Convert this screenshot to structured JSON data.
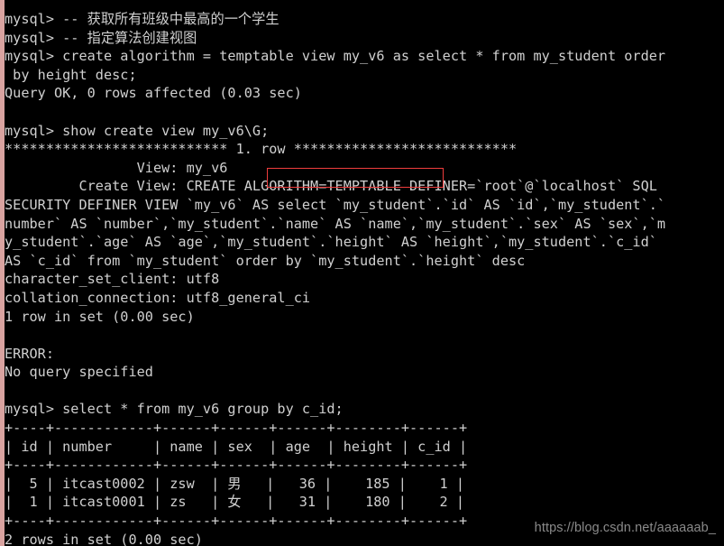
{
  "terminal": {
    "title": "MySQL Console",
    "background_color": "#000000",
    "foreground_color": "#d0d0d0",
    "left_edge_color": "#d9a3a0",
    "highlight_color": "#ef3d3d",
    "highlighted_text": "ALGORITHM=TEMPTABLE",
    "prompt": "mysql>",
    "lines": [
      "mysql> -- 获取所有班级中最高的一个学生",
      "mysql> -- 指定算法创建视图",
      "mysql> create algorithm = temptable view my_v6 as select * from my_student order",
      " by height desc;",
      "Query OK, 0 rows affected (0.03 sec)",
      "",
      "mysql> show create view my_v6\\G;",
      "*************************** 1. row ***************************",
      "                View: my_v6",
      "         Create View: CREATE ALGORITHM=TEMPTABLE DEFINER=`root`@`localhost` SQL",
      "SECURITY DEFINER VIEW `my_v6` AS select `my_student`.`id` AS `id`,`my_student`.`",
      "number` AS `number`,`my_student`.`name` AS `name`,`my_student`.`sex` AS `sex`,`m",
      "y_student`.`age` AS `age`,`my_student`.`height` AS `height`,`my_student`.`c_id`",
      "AS `c_id` from `my_student` order by `my_student`.`height` desc",
      "character_set_client: utf8",
      "collation_connection: utf8_general_ci",
      "1 row in set (0.00 sec)",
      "",
      "ERROR:",
      "No query specified",
      "",
      "mysql> select * from my_v6 group by c_id;",
      "+----+------------+------+------+------+--------+------+",
      "| id | number     | name | sex  | age  | height | c_id |",
      "+----+------------+------+------+------+--------+------+",
      "|  5 | itcast0002 | zsw  | 男   |   36 |    185 |    1 |",
      "|  1 | itcast0001 | zs   | 女   |   31 |    180 |    2 |",
      "+----+------------+------+------+------+--------+------+",
      "2 rows in set (0.00 sec)"
    ]
  },
  "commands": {
    "comment_1": "-- 获取所有班级中最高的一个学生",
    "comment_2": "-- 指定算法创建视图",
    "create_view": "create algorithm = temptable view my_v6 as select * from my_student order by height desc;",
    "show_create_view": "show create view my_v6\\G;",
    "select_view": "select * from my_v6 group by c_id;"
  },
  "results": {
    "create_status": "Query OK, 0 rows affected (0.03 sec)",
    "show_row_separator": "*************************** 1. row ***************************",
    "view_name_label": "View:",
    "view_name_value": "my_v6",
    "create_view_label": "Create View:",
    "character_set_client_label": "character_set_client:",
    "character_set_client_value": "utf8",
    "collation_connection_label": "collation_connection:",
    "collation_connection_value": "utf8_general_ci",
    "show_status": "1 row in set (0.00 sec)",
    "error_label": "ERROR:",
    "error_message": "No query specified",
    "select_status": "2 rows in set (0.00 sec)"
  },
  "result_table": {
    "columns": [
      "id",
      "number",
      "name",
      "sex",
      "age",
      "height",
      "c_id"
    ],
    "rows": [
      [
        "5",
        "itcast0002",
        "zsw",
        "男",
        "36",
        "185",
        "1"
      ],
      [
        "1",
        "itcast0001",
        "zs",
        "女",
        "31",
        "180",
        "2"
      ]
    ]
  },
  "watermark": {
    "text": "https://blog.csdn.net/aaaaaab_"
  }
}
